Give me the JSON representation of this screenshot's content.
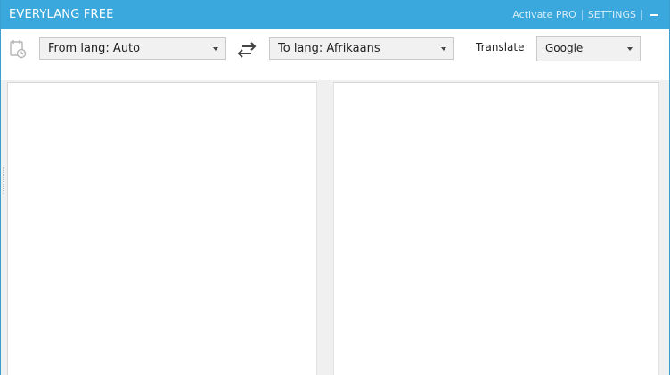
{
  "titlebar": {
    "app_title": "EVERYLANG FREE",
    "activate_label": "Activate PRO",
    "settings_label": "SETTINGS",
    "bg_color": "#3aa8dc"
  },
  "toolbar": {
    "history_icon": "history-icon",
    "from_lang_label": "From lang: Auto",
    "swap_icon": "swap-arrows-icon",
    "to_lang_label": "To lang: Afrikaans",
    "translate_label": "Translate",
    "engine_label": "Google"
  },
  "panes": {
    "source_text": "",
    "target_text": ""
  }
}
